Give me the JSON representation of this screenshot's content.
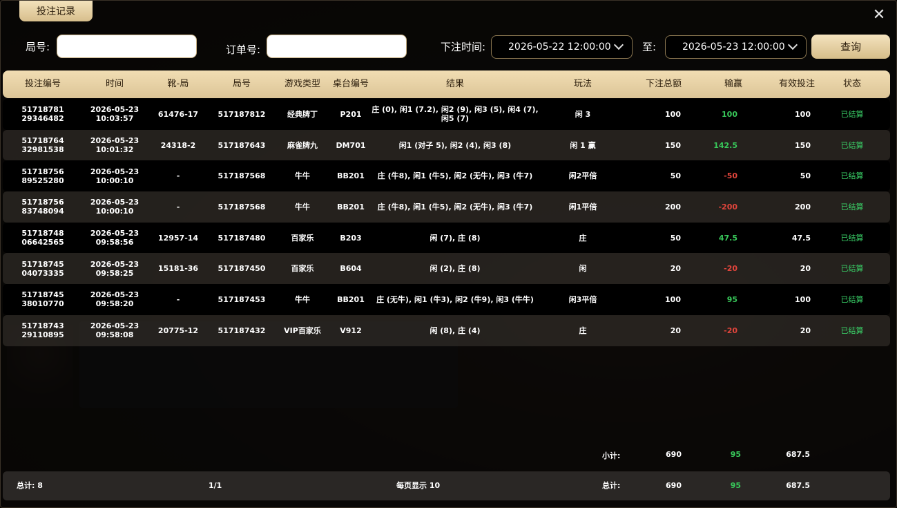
{
  "title": "投注记录",
  "filters": {
    "round_label": "局号:",
    "order_label": "订单号:",
    "time_label": "下注时间:",
    "to_label": "至:",
    "start_date": "2026-05-22 12:00:00",
    "end_date": "2026-05-23 12:00:00",
    "query_button": "查询"
  },
  "columns": [
    "投注编号",
    "时间",
    "靴-局",
    "局号",
    "游戏类型",
    "桌台编号",
    "结果",
    "玩法",
    "下注总额",
    "输赢",
    "有效投注",
    "状态"
  ],
  "rows": [
    {
      "id1": "51718781",
      "id2": "29346482",
      "date": "2026-05-23",
      "time": "10:03:57",
      "shoe": "61476-17",
      "round": "517187812",
      "game": "经典牌丁",
      "table": "P201",
      "result": "庄 (0), 闲1 (7.2), 闲2 (9), 闲3 (5), 闲4 (7), 闲5 (7)",
      "play": "闲 3",
      "bet": "100",
      "win": "100",
      "valid": "100",
      "status": "已结算"
    },
    {
      "id1": "51718764",
      "id2": "32981538",
      "date": "2026-05-23",
      "time": "10:01:32",
      "shoe": "24318-2",
      "round": "517187643",
      "game": "麻雀牌九",
      "table": "DM701",
      "result": "闲1 (对子 5), 闲2 (4), 闲3 (8)",
      "play": "闲 1 赢",
      "bet": "150",
      "win": "142.5",
      "valid": "150",
      "status": "已结算"
    },
    {
      "id1": "51718756",
      "id2": "89525280",
      "date": "2026-05-23",
      "time": "10:00:10",
      "shoe": "-",
      "round": "517187568",
      "game": "牛牛",
      "table": "BB201",
      "result": "庄 (牛8), 闲1 (牛5), 闲2 (无牛), 闲3 (牛7)",
      "play": "闲2平倍",
      "bet": "50",
      "win": "-50",
      "valid": "50",
      "status": "已结算"
    },
    {
      "id1": "51718756",
      "id2": "83748094",
      "date": "2026-05-23",
      "time": "10:00:10",
      "shoe": "-",
      "round": "517187568",
      "game": "牛牛",
      "table": "BB201",
      "result": "庄 (牛8), 闲1 (牛5), 闲2 (无牛), 闲3 (牛7)",
      "play": "闲1平倍",
      "bet": "200",
      "win": "-200",
      "valid": "200",
      "status": "已结算"
    },
    {
      "id1": "51718748",
      "id2": "06642565",
      "date": "2026-05-23",
      "time": "09:58:56",
      "shoe": "12957-14",
      "round": "517187480",
      "game": "百家乐",
      "table": "B203",
      "result": "闲 (7), 庄 (8)",
      "play": "庄",
      "bet": "50",
      "win": "47.5",
      "valid": "47.5",
      "status": "已结算"
    },
    {
      "id1": "51718745",
      "id2": "04073335",
      "date": "2026-05-23",
      "time": "09:58:25",
      "shoe": "15181-36",
      "round": "517187450",
      "game": "百家乐",
      "table": "B604",
      "result": "闲 (2), 庄 (8)",
      "play": "闲",
      "bet": "20",
      "win": "-20",
      "valid": "20",
      "status": "已结算"
    },
    {
      "id1": "51718745",
      "id2": "38010770",
      "date": "2026-05-23",
      "time": "09:58:20",
      "shoe": "-",
      "round": "517187453",
      "game": "牛牛",
      "table": "BB201",
      "result": "庄 (无牛), 闲1 (牛3), 闲2 (牛9), 闲3 (牛牛)",
      "play": "闲3平倍",
      "bet": "100",
      "win": "95",
      "valid": "100",
      "status": "已结算"
    },
    {
      "id1": "51718743",
      "id2": "29110895",
      "date": "2026-05-23",
      "time": "09:58:08",
      "shoe": "20775-12",
      "round": "517187432",
      "game": "VIP百家乐",
      "table": "V912",
      "result": "闲 (8), 庄 (4)",
      "play": "庄",
      "bet": "20",
      "win": "-20",
      "valid": "20",
      "status": "已结算"
    }
  ],
  "subtotal": {
    "label": "小计:",
    "bet": "690",
    "win": "95",
    "valid": "687.5"
  },
  "footer": {
    "count": "总计: 8",
    "page": "1/1",
    "per_page": "每页显示 10",
    "label": "总计:",
    "bet": "690",
    "win": "95",
    "valid": "687.5"
  },
  "colors": {
    "gold": "#dcc597",
    "positive": "#38c85a",
    "negative": "#e2453c",
    "status": "#3ad268"
  }
}
